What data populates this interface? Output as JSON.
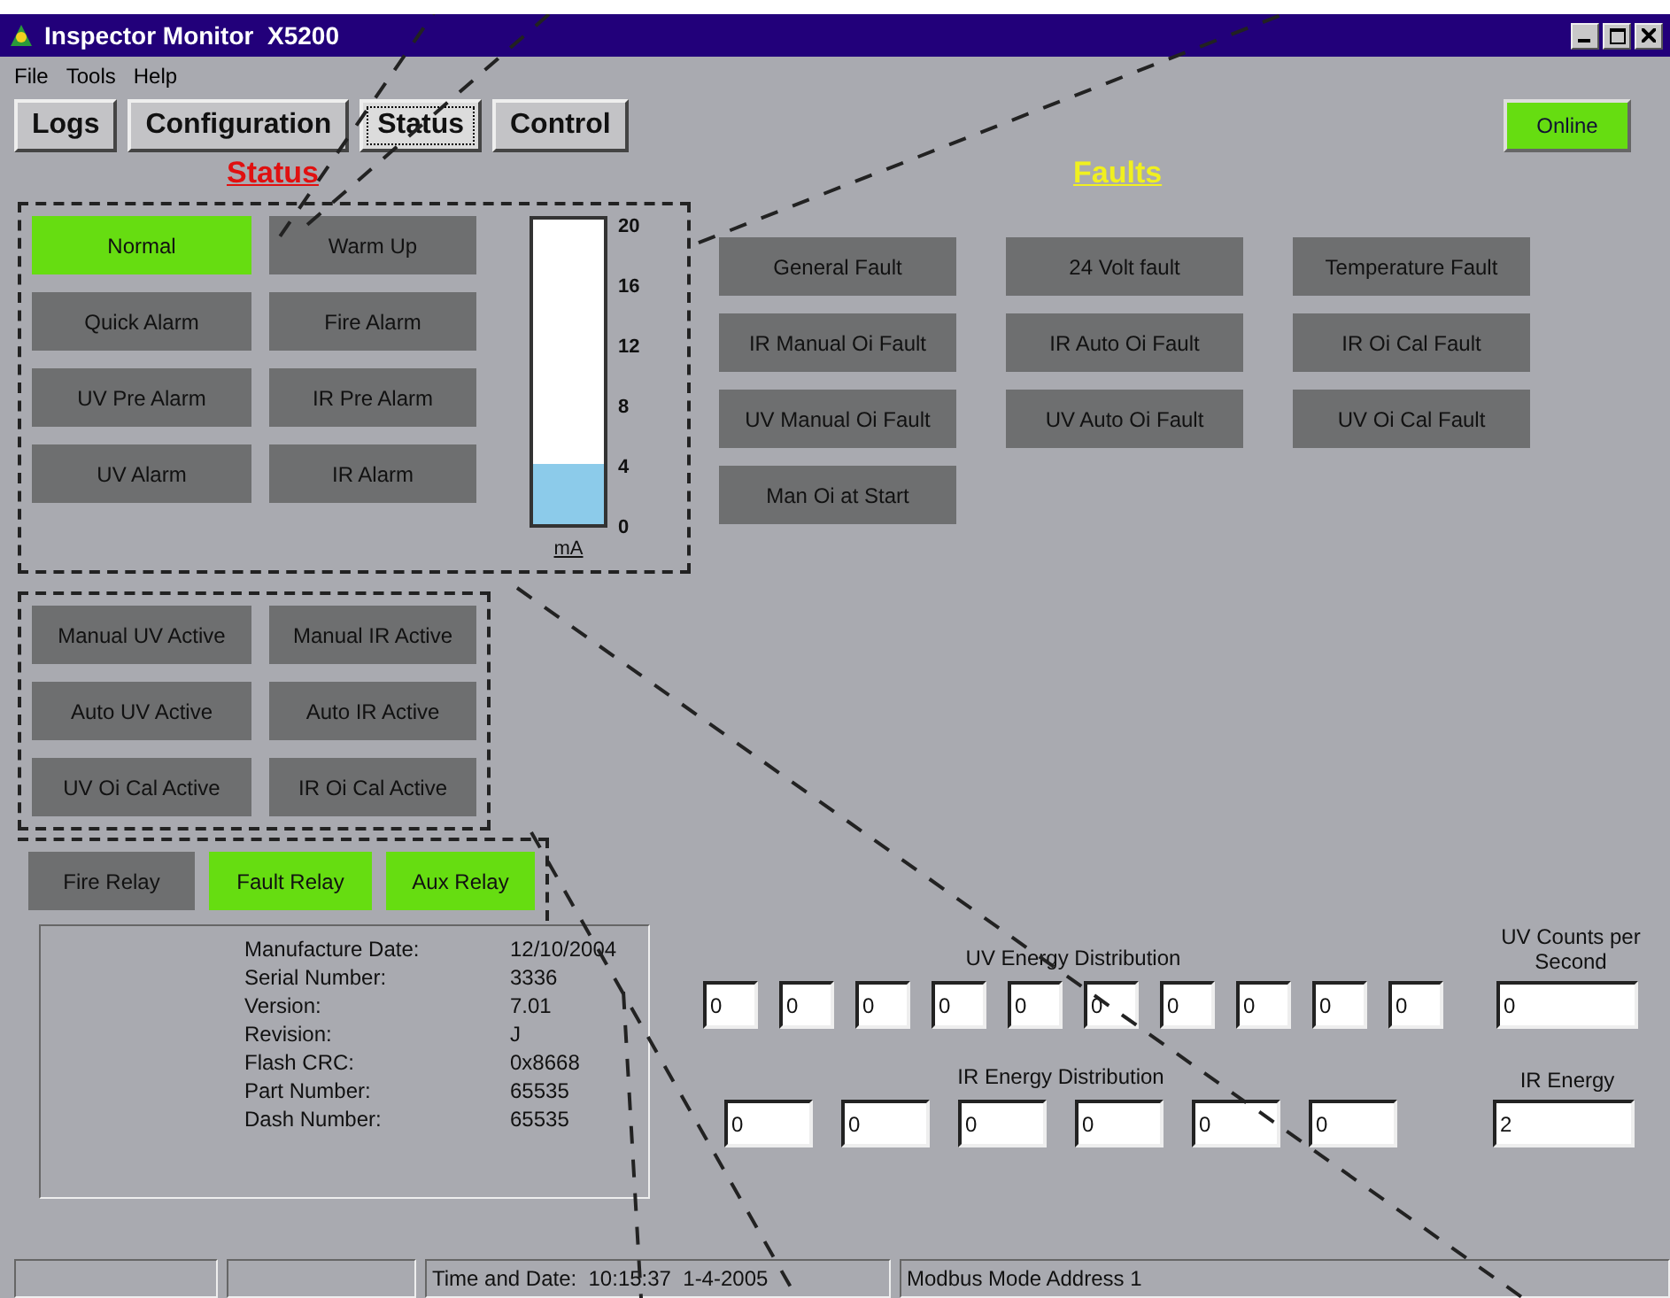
{
  "window": {
    "title": "Inspector Monitor  X5200"
  },
  "menu": [
    "File",
    "Tools",
    "Help"
  ],
  "tabs": [
    {
      "label": "Logs",
      "selected": false
    },
    {
      "label": "Configuration",
      "selected": false
    },
    {
      "label": "Status",
      "selected": true
    },
    {
      "label": "Control",
      "selected": false
    }
  ],
  "connection": {
    "label": "Online",
    "on": true
  },
  "status_heading": "Status",
  "alarm_indicators": [
    {
      "label": "Normal",
      "on": true
    },
    {
      "label": "Quick Alarm",
      "on": false
    },
    {
      "label": "UV Pre Alarm",
      "on": false
    },
    {
      "label": "UV Alarm",
      "on": false
    },
    {
      "label": "Warm Up",
      "on": false
    },
    {
      "label": "Fire Alarm",
      "on": false
    },
    {
      "label": "IR Pre Alarm",
      "on": false
    },
    {
      "label": "IR Alarm",
      "on": false
    }
  ],
  "current_meter": {
    "level": 0.2,
    "ticks": [
      "20",
      "16",
      "12",
      "8",
      "4",
      "0"
    ],
    "unit": "mA"
  },
  "active_indicators": [
    {
      "label": "Manual UV Active",
      "on": false
    },
    {
      "label": "Auto UV Active",
      "on": false
    },
    {
      "label": "UV Oi Cal Active",
      "on": false
    },
    {
      "label": "Manual IR Active",
      "on": false
    },
    {
      "label": "Auto IR Active",
      "on": false
    },
    {
      "label": "IR Oi Cal Active",
      "on": false
    }
  ],
  "relays": [
    {
      "label": "Fire Relay",
      "on": false
    },
    {
      "label": "Fault Relay",
      "on": true
    },
    {
      "label": "Aux Relay",
      "on": true
    }
  ],
  "faults": {
    "heading": "Faults",
    "items": [
      {
        "label": "General Fault",
        "on": false
      },
      {
        "label": "24 Volt fault",
        "on": false
      },
      {
        "label": "Temperature Fault",
        "on": false
      },
      {
        "label": "IR Manual Oi Fault",
        "on": false
      },
      {
        "label": "IR Auto Oi Fault",
        "on": false
      },
      {
        "label": "IR Oi Cal Fault",
        "on": false
      },
      {
        "label": "UV Manual Oi Fault",
        "on": false
      },
      {
        "label": "UV Auto Oi Fault",
        "on": false
      },
      {
        "label": "UV Oi Cal Fault",
        "on": false
      },
      {
        "label": "Man Oi at Start",
        "on": false
      }
    ]
  },
  "device_info": [
    {
      "label": "Manufacture Date:",
      "value": "12/10/2004"
    },
    {
      "label": "Serial Number:",
      "value": "3336"
    },
    {
      "label": "Version:",
      "value": "7.01"
    },
    {
      "label": "Revision:",
      "value": "J"
    },
    {
      "label": "Flash CRC:",
      "value": "0x8668"
    },
    {
      "label": "Part Number:",
      "value": "65535"
    },
    {
      "label": "Dash Number:",
      "value": "65535"
    }
  ],
  "uv_energy_distribution": {
    "label": "UV Energy Distribution",
    "values": [
      "0",
      "0",
      "0",
      "0",
      "0",
      "0",
      "0",
      "0",
      "0",
      "0"
    ]
  },
  "uv_counts": {
    "label": "UV Counts per Second",
    "value": "0"
  },
  "ir_energy_distribution": {
    "label": "IR Energy Distribution",
    "values": [
      "0",
      "0",
      "0",
      "0",
      "0",
      "0"
    ]
  },
  "ir_energy": {
    "label": "IR Energy",
    "value": "2"
  },
  "status_bar": {
    "time_date": "Time and Date:  10:15:37  1-4-2005",
    "mode": "Modbus Mode Address 1"
  }
}
